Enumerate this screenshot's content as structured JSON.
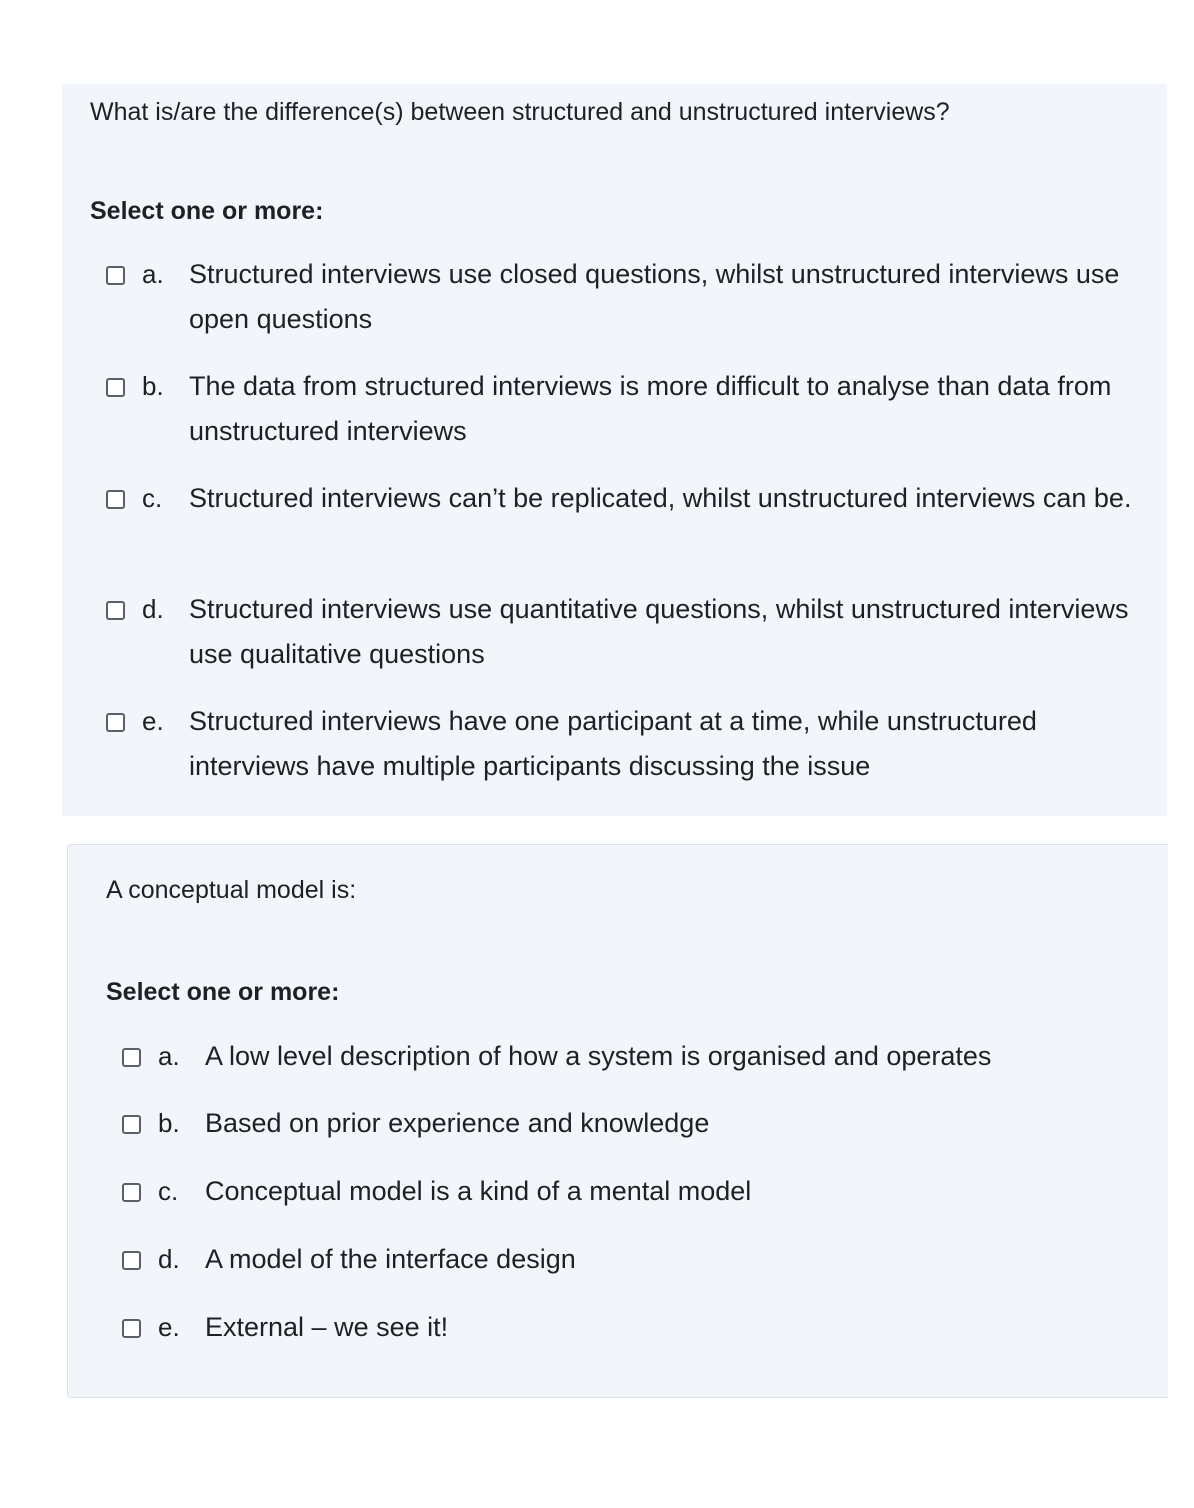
{
  "q1": {
    "text": "What is/are the difference(s) between structured and unstructured interviews?",
    "prompt": "Select one or more:",
    "options": [
      {
        "letter": "a.",
        "text": "Structured interviews use closed questions, whilst unstructured interviews use open questions"
      },
      {
        "letter": "b.",
        "text": "The data from structured interviews is more difficult to analyse than data from unstructured interviews"
      },
      {
        "letter": "c.",
        "text": "Structured interviews can’t be replicated, whilst unstructured interviews can be."
      },
      {
        "letter": "d.",
        "text": "Structured interviews use quantitative questions, whilst unstructured interviews use qualitative questions"
      },
      {
        "letter": "e.",
        "text": "Structured interviews have one participant at a time, while unstructured interviews have multiple participants discussing the issue"
      }
    ]
  },
  "q2": {
    "text": "A conceptual model is:",
    "prompt": "Select one or more:",
    "options": [
      {
        "letter": "a.",
        "text": "A low level description of how a system is organised and operates"
      },
      {
        "letter": "b.",
        "text": "Based on prior experience and knowledge"
      },
      {
        "letter": "c.",
        "text": "Conceptual model is a kind of a mental model"
      },
      {
        "letter": "d.",
        "text": "A model of the interface design"
      },
      {
        "letter": "e.",
        "text": "External – we see it!"
      }
    ]
  }
}
